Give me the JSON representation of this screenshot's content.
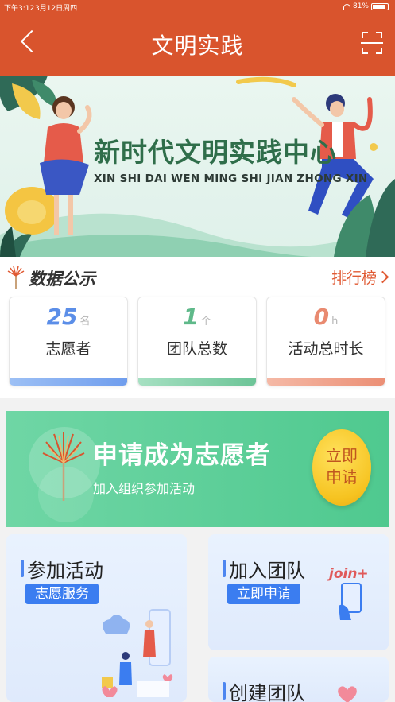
{
  "status": {
    "time": "下午3:12",
    "date": "3月12日周四",
    "battery": "81%"
  },
  "header": {
    "title": "文明实践"
  },
  "banner": {
    "title": "新时代文明实践中心",
    "subtitle": "XIN SHI DAI WEN MING SHI JIAN ZHONG XIN"
  },
  "data_section": {
    "title": "数据公示",
    "rank_label": "排行榜",
    "cards": [
      {
        "value": "25",
        "unit": "名",
        "label": "志愿者",
        "value_color": "#5b8ee8",
        "bar_color": "#7ba7ee"
      },
      {
        "value": "1",
        "unit": "个",
        "label": "团队总数",
        "value_color": "#5fb98a",
        "bar_color": "#77c9a0"
      },
      {
        "value": "0",
        "unit": "h",
        "label": "活动总时长",
        "value_color": "#e98a70",
        "bar_color": "#ef9e88"
      }
    ]
  },
  "apply": {
    "title": "申请成为志愿者",
    "subtitle": "加入组织参加活动",
    "button_line1": "立即",
    "button_line2": "申请"
  },
  "tiles": {
    "join_activity": {
      "title": "参加活动",
      "pill": "志愿服务"
    },
    "join_team": {
      "title": "加入团队",
      "pill": "立即申请",
      "decor_text": "join+"
    },
    "create_team": {
      "title": "创建团队"
    }
  },
  "colors": {
    "header": "#d9542d",
    "accent_green": "#4fc98f",
    "accent_blue": "#3b7df0"
  }
}
